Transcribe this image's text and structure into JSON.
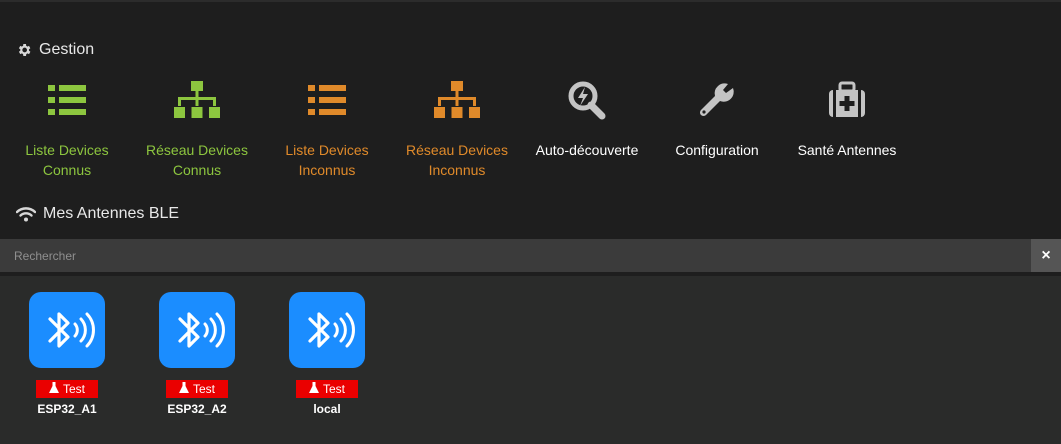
{
  "gestion": {
    "title": "Gestion",
    "tiles": [
      {
        "label": "Liste Devices Connus",
        "icon": "list-icon",
        "color": "#8dc63f"
      },
      {
        "label": "Réseau Devices Connus",
        "icon": "network-icon",
        "color": "#8dc63f"
      },
      {
        "label": "Liste Devices Inconnus",
        "icon": "list-icon",
        "color": "#e08a2a"
      },
      {
        "label": "Réseau Devices Inconnus",
        "icon": "network-icon",
        "color": "#e08a2a"
      },
      {
        "label": "Auto-découverte",
        "icon": "magnify-bolt-icon",
        "color": "#ffffff"
      },
      {
        "label": "Configuration",
        "icon": "wrench-icon",
        "color": "#ffffff"
      },
      {
        "label": "Santé Antennes",
        "icon": "medkit-icon",
        "color": "#ffffff"
      }
    ]
  },
  "antennes": {
    "title": "Mes Antennes BLE",
    "search_placeholder": "Rechercher",
    "clear_label": "×",
    "items": [
      {
        "name": "ESP32_A1",
        "badge": "Test"
      },
      {
        "name": "ESP32_A2",
        "badge": "Test"
      },
      {
        "name": "local",
        "badge": "Test"
      }
    ]
  },
  "colors": {
    "accent_green": "#8dc63f",
    "accent_orange": "#e08a2a",
    "bluetooth_blue": "#1b8dff",
    "badge_red": "#ea0000"
  }
}
